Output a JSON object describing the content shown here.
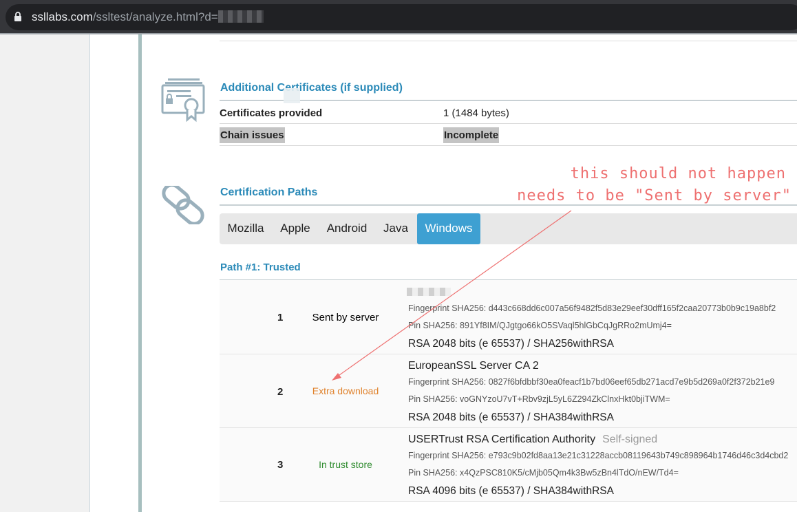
{
  "browser": {
    "url_host": "ssllabs.com",
    "url_path": "/ssltest/analyze.html?d="
  },
  "additional_certs": {
    "title": "Additional Certificates (if supplied)",
    "rows": [
      {
        "label": "Certificates provided",
        "value": "1 (1484 bytes)"
      },
      {
        "label": "Chain issues",
        "value": "Incomplete"
      }
    ]
  },
  "cert_paths": {
    "title": "Certification Paths",
    "tabs": [
      "Mozilla",
      "Apple",
      "Android",
      "Java",
      "Windows"
    ],
    "active_tab": "Windows",
    "path_title": "Path #1: Trusted",
    "certs": [
      {
        "num": "1",
        "status": "Sent by server",
        "status_color": "#333333",
        "name": "",
        "self_signed": "",
        "fingerprint": "Fingerprint SHA256: d443c668dd6c007a56f9482f5d83e29eef30dff165f2caa20773b0b9c19a8bf2",
        "pin": "Pin SHA256: 891Yf8IM/QJgtgo66kO5SVaql5hlGbCqJgRRo2mUmj4=",
        "key": "RSA 2048 bits (e 65537) / SHA256withRSA"
      },
      {
        "num": "2",
        "status": "Extra download",
        "status_color": "#e0832e",
        "name": "EuropeanSSL Server CA 2",
        "self_signed": "",
        "fingerprint": "Fingerprint SHA256: 0827f6bfdbbf30ea0feacf1b7bd06eef65db271acd7e9b5d269a0f2f372b21e9",
        "pin": "Pin SHA256: voGNYzoU7vT+Rbv9zjL5yL6Z294ZkClnxHkt0bjiTWM=",
        "key": "RSA 2048 bits (e 65537) / SHA384withRSA"
      },
      {
        "num": "3",
        "status": "In trust store",
        "status_color": "#2e8b2e",
        "name": "USERTrust RSA Certification Authority",
        "self_signed": "Self-signed",
        "fingerprint": "Fingerprint SHA256: e793c9b02fd8aa13e21c31228accb08119643b749c898964b1746d46c3d4cbd2",
        "pin": "Pin SHA256: x4QzPSC810K5/cMjb05Qm4k3Bw5zBn4lTdO/nEW/Td4=",
        "key": "RSA 4096 bits (e 65537) / SHA384withRSA"
      }
    ]
  },
  "annotation": {
    "line1": "this should not happen",
    "line2": "needs to be \"Sent by server\"",
    "color": "#ee7070"
  },
  "colors": {
    "accent": "#2b8ab8",
    "tab_active": "#3ea0d2"
  }
}
